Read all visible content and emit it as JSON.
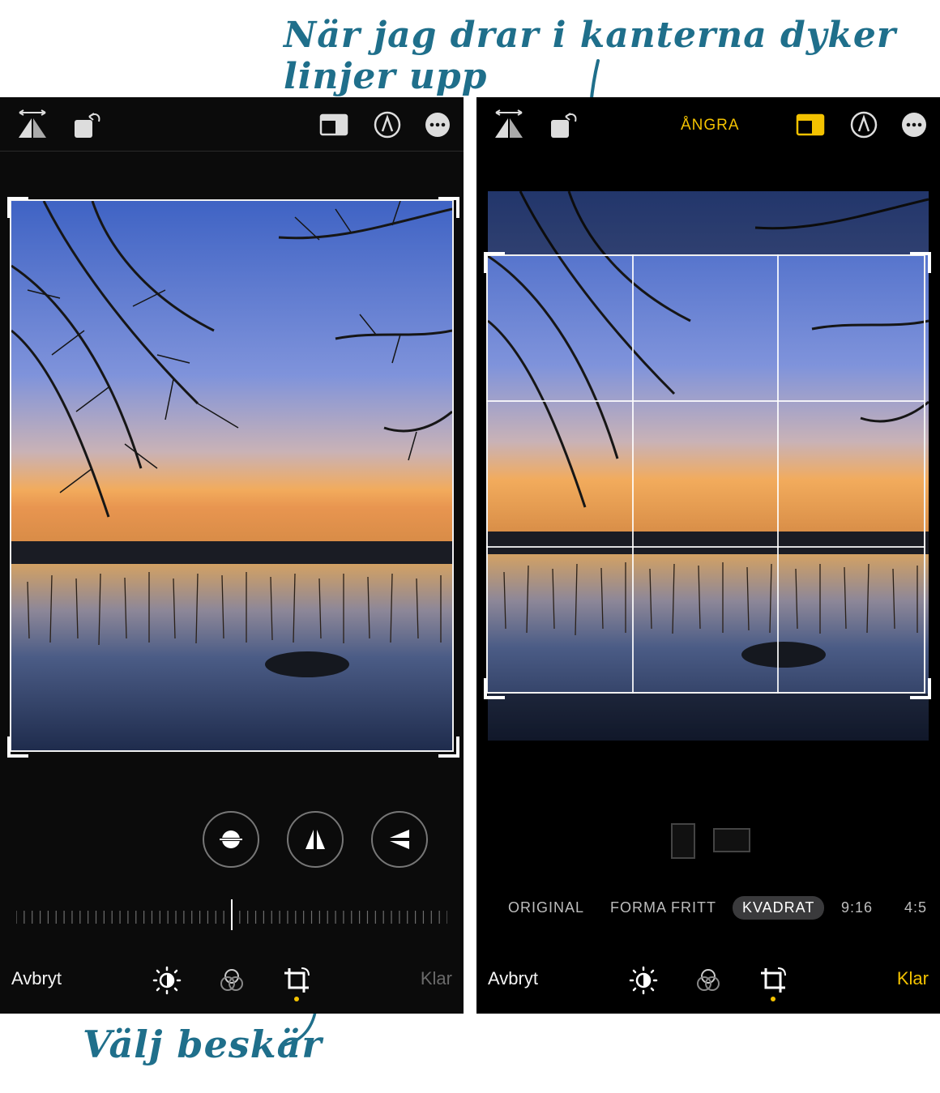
{
  "annotations": {
    "top": "När jag drar i kanterna dyker linjer upp",
    "bottom": "Välj beskär"
  },
  "left_screen": {
    "toolbar_icons": [
      "flip-horizontal-icon",
      "rotate-icon",
      "aspect-ratio-icon",
      "markup-icon",
      "more-icon"
    ],
    "straighten_buttons": [
      "straighten-icon",
      "vertical-perspective-icon",
      "horizontal-perspective-icon"
    ],
    "cancel_label": "Avbryt",
    "done_label": "Klar",
    "bottom_tools": [
      "adjust-icon",
      "filters-icon",
      "crop-icon"
    ],
    "selected_tool": "crop-icon"
  },
  "right_screen": {
    "undo_label": "ÅNGRA",
    "toolbar_icons": [
      "flip-horizontal-icon",
      "rotate-icon",
      "aspect-ratio-icon",
      "markup-icon",
      "more-icon"
    ],
    "aspect_options": [
      "ORIGINAL",
      "FORMA FRITT",
      "KVADRAT",
      "9:16",
      "4:5"
    ],
    "selected_aspect": "KVADRAT",
    "cancel_label": "Avbryt",
    "done_label": "Klar",
    "bottom_tools": [
      "adjust-icon",
      "filters-icon",
      "crop-icon"
    ],
    "selected_tool": "crop-icon"
  },
  "colors": {
    "accent": "#f3c200",
    "annotation": "#1f6f8b",
    "background": "#000000"
  }
}
